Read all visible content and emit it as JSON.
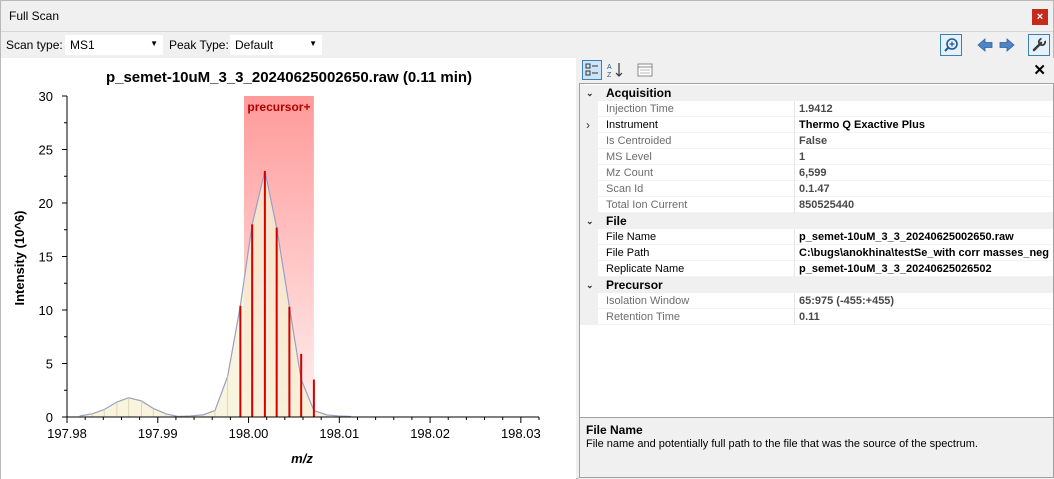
{
  "window": {
    "title": "Full Scan",
    "close_glyph": "×"
  },
  "toolbar": {
    "scan_type_label": "Scan type:",
    "scan_type_value": "MS1",
    "peak_type_label": "Peak Type:",
    "peak_type_value": "Default",
    "icons": [
      "zoom-icon",
      "arrow-left-icon",
      "arrow-right-icon",
      "wrench-icon"
    ]
  },
  "chart_data": {
    "type": "line",
    "title": "p_semet-10uM_3_3_20240625002650.raw  (0.11 min)",
    "xlabel": "m/z",
    "ylabel": "Intensity (10^6)",
    "xlim": [
      197.98,
      198.032
    ],
    "ylim": [
      0,
      30
    ],
    "x_ticks": [
      197.98,
      197.99,
      198.0,
      198.01,
      198.02,
      198.03
    ],
    "x_tick_labels": [
      "197.98",
      "197.99",
      "198.00",
      "198.01",
      "198.02",
      "198.03"
    ],
    "y_ticks": [
      0,
      5,
      10,
      15,
      20,
      25,
      30
    ],
    "y_tick_labels": [
      "0",
      "5",
      "10",
      "15",
      "20",
      "25",
      "30"
    ],
    "profile": {
      "x": [
        197.9814,
        197.9828,
        197.9841,
        197.9855,
        197.9868,
        197.9882,
        197.9895,
        197.9909,
        197.9922,
        197.9936,
        197.995,
        197.9963,
        197.9977,
        197.9991,
        198.0004,
        198.0018,
        198.0031,
        198.0045,
        198.0058,
        198.0072,
        198.0086,
        198.0099,
        198.0113
      ],
      "y": [
        0.1,
        0.3,
        0.7,
        1.4,
        1.8,
        1.5,
        0.8,
        0.3,
        0.05,
        0.1,
        0.2,
        0.6,
        3.8,
        10.4,
        18.0,
        23.0,
        17.7,
        10.3,
        3.5,
        0.6,
        0.2,
        0.1,
        0.05
      ]
    },
    "precursor_window": {
      "label": "precursor+",
      "x_start": 197.9995,
      "x_end": 198.0072
    },
    "centroid_sticks": {
      "x": [
        197.9991,
        198.0004,
        198.0018,
        198.0031,
        198.0045,
        198.0058,
        198.0072
      ],
      "y": [
        10.4,
        18.0,
        23.0,
        17.7,
        10.3,
        5.9,
        3.5
      ]
    },
    "colors": {
      "profile_fill": "#f5f0d2",
      "profile_line": "#9b9fc4",
      "stick": "#d40000",
      "window_top": "#ff9a9a",
      "window_bottom": "#fff0f0"
    },
    "grid": false
  },
  "grid_tools": {
    "close_glyph": "✕"
  },
  "property_grid": {
    "categories": [
      {
        "name": "Acquisition",
        "props": [
          {
            "name": "Injection Time",
            "value": "1.9412",
            "strong": false
          },
          {
            "name": "Instrument",
            "value": "Thermo Q Exactive Plus",
            "strong": true,
            "expandable": true
          },
          {
            "name": "Is Centroided",
            "value": "False",
            "strong": false
          },
          {
            "name": "MS Level",
            "value": "1",
            "strong": false
          },
          {
            "name": "Mz Count",
            "value": "6,599",
            "strong": false
          },
          {
            "name": "Scan Id",
            "value": "0.1.47",
            "strong": false
          },
          {
            "name": "Total Ion Current",
            "value": "850525440",
            "strong": false
          }
        ]
      },
      {
        "name": "File",
        "props": [
          {
            "name": "File Name",
            "value": "p_semet-10uM_3_3_20240625002650.raw",
            "strong": true
          },
          {
            "name": "File Path",
            "value": "C:\\bugs\\anokhina\\testSe_with corr masses_neg",
            "strong": true
          },
          {
            "name": "Replicate Name",
            "value": "p_semet-10uM_3_3_20240625026502",
            "strong": true
          }
        ]
      },
      {
        "name": "Precursor",
        "props": [
          {
            "name": "Isolation Window",
            "value": "65:975 (-455:+455)",
            "strong": false
          },
          {
            "name": "Retention Time",
            "value": "0.11",
            "strong": false
          }
        ]
      }
    ]
  },
  "description": {
    "title": "File Name",
    "text": "File name and potentially full path to the file that was the source of the spectrum."
  }
}
